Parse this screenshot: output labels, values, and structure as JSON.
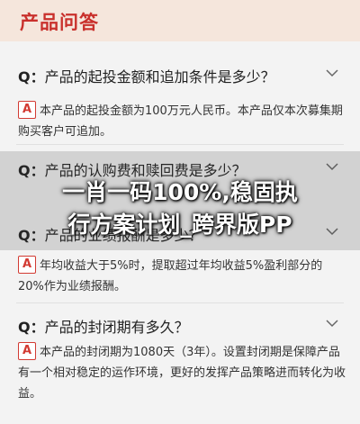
{
  "header": {
    "title": "产品问答"
  },
  "faq": [
    {
      "question": "产品的起投金额和追加条件是多少？",
      "answer": "本产品的起投金额为100万元人民币。本产品仅本次募集期购买客户可追加。"
    },
    {
      "question": "产品的认购费和赎回费是多少？",
      "answer": ""
    },
    {
      "question": "产品的业绩报酬是多少？",
      "answer": "年均收益大于5%时，提取超过年均收益5%盈利部分的20%作为业绩报酬。"
    },
    {
      "question": "产品的封闭期有多久？",
      "answer": "本产品的封闭期为1080天（3年）。设置封闭期是保障产品有一个相对稳定的运作环境，更好的发挥产品策略进而转化为收益。"
    }
  ],
  "labels": {
    "q_prefix": "Q：",
    "a_badge": "A"
  },
  "overlay": {
    "line1": "一肖一码100%,稳固执",
    "line2": "行方案计划_跨界版PP"
  },
  "colors": {
    "accent": "#d23a32",
    "header_bg": "#f5e6dc"
  },
  "icons": {
    "expand": "chevron-down-icon"
  }
}
